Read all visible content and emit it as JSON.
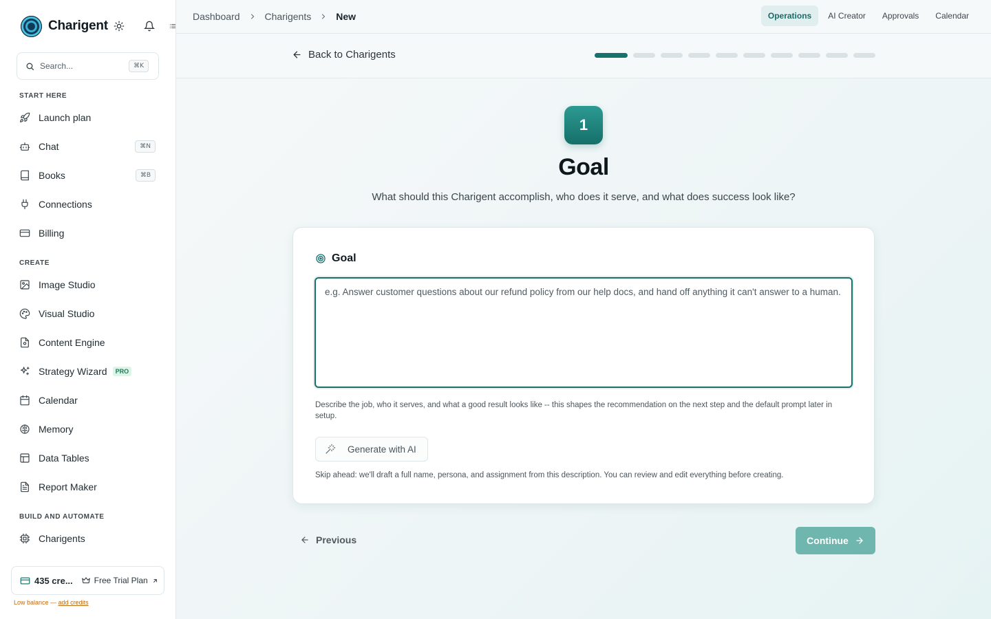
{
  "brand": {
    "name": "Charigent"
  },
  "search": {
    "placeholder": "Search...",
    "shortcut": "⌘K"
  },
  "sidebar": {
    "sections": [
      {
        "label": "START HERE"
      },
      {
        "label": "CREATE"
      },
      {
        "label": "BUILD AND AUTOMATE"
      }
    ],
    "items": [
      {
        "label": "Launch plan",
        "icon": "rocket-icon"
      },
      {
        "label": "Chat",
        "icon": "bot-icon",
        "shortcut": "⌘N"
      },
      {
        "label": "Books",
        "icon": "book-icon",
        "shortcut": "⌘B"
      },
      {
        "label": "Connections",
        "icon": "plug-icon"
      },
      {
        "label": "Billing",
        "icon": "credit-card-icon"
      },
      {
        "label": "Image Studio",
        "icon": "image-icon"
      },
      {
        "label": "Visual Studio",
        "icon": "palette-icon"
      },
      {
        "label": "Content Engine",
        "icon": "file-icon"
      },
      {
        "label": "Strategy Wizard",
        "icon": "sparkles-icon",
        "badge": "PRO"
      },
      {
        "label": "Calendar",
        "icon": "calendar-icon"
      },
      {
        "label": "Memory",
        "icon": "brain-icon"
      },
      {
        "label": "Data Tables",
        "icon": "table-icon"
      },
      {
        "label": "Report Maker",
        "icon": "report-icon"
      },
      {
        "label": "Charigents",
        "icon": "cpu-icon"
      }
    ]
  },
  "credits": {
    "text": "435 cre...",
    "plan": "Free Trial Plan",
    "warning": "Low balance — ",
    "warning_link": "add credits"
  },
  "breadcrumb": {
    "items": [
      "Dashboard",
      "Charigents",
      "New"
    ]
  },
  "top_tabs": [
    "Operations",
    "AI Creator",
    "Approvals",
    "Calendar"
  ],
  "subheader": {
    "back_label": "Back to Charigents",
    "total_steps": 10,
    "current_step": 1
  },
  "step": {
    "number": "1",
    "title": "Goal",
    "subtitle": "What should this Charigent accomplish, who does it serve, and what does success look like?"
  },
  "card": {
    "label": "Goal",
    "placeholder": "e.g. Answer customer questions about our refund policy from our help docs, and hand off anything it can't answer to a human.",
    "value": "",
    "help": "Describe the job, who it serves, and what a good result looks like -- this shapes the recommendation on the next step and the default prompt later in setup.",
    "generate_label": "Generate with AI",
    "skip_text": "Skip ahead: we'll draft a full name, persona, and assignment from this description. You can review and edit everything before creating."
  },
  "footer": {
    "previous_label": "Previous",
    "continue_label": "Continue"
  },
  "colors": {
    "accent": "#17716d",
    "continue_bg": "#6fb6ae",
    "warning": "#c06a12"
  }
}
